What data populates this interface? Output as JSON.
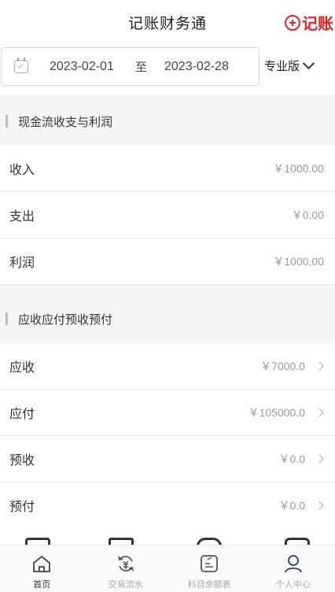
{
  "header": {
    "title": "记账财务通",
    "add_label": "记账"
  },
  "date_range": {
    "start": "2023-02-01",
    "separator": "至",
    "end": "2023-02-28",
    "edition": "专业版"
  },
  "cashflow": {
    "title": "现金流收支与利润",
    "rows": [
      {
        "label": "收入",
        "value": "￥1000.00"
      },
      {
        "label": "支出",
        "value": "￥0.00"
      },
      {
        "label": "利润",
        "value": "￥1000.00"
      }
    ]
  },
  "receivables": {
    "title": "应收应付预收预付",
    "rows": [
      {
        "label": "应收",
        "value": "￥7000.0"
      },
      {
        "label": "应付",
        "value": "￥105000.0"
      },
      {
        "label": "预收",
        "value": "￥0.0"
      },
      {
        "label": "预付",
        "value": "￥0.0"
      }
    ]
  },
  "tabs": [
    {
      "label": "首页",
      "icon": "home-icon",
      "active": true
    },
    {
      "label": "交易流水",
      "icon": "transactions-icon",
      "active": false
    },
    {
      "label": "科目余额表",
      "icon": "ledger-icon",
      "active": false
    },
    {
      "label": "个人中心",
      "icon": "user-icon",
      "active": false
    }
  ]
}
